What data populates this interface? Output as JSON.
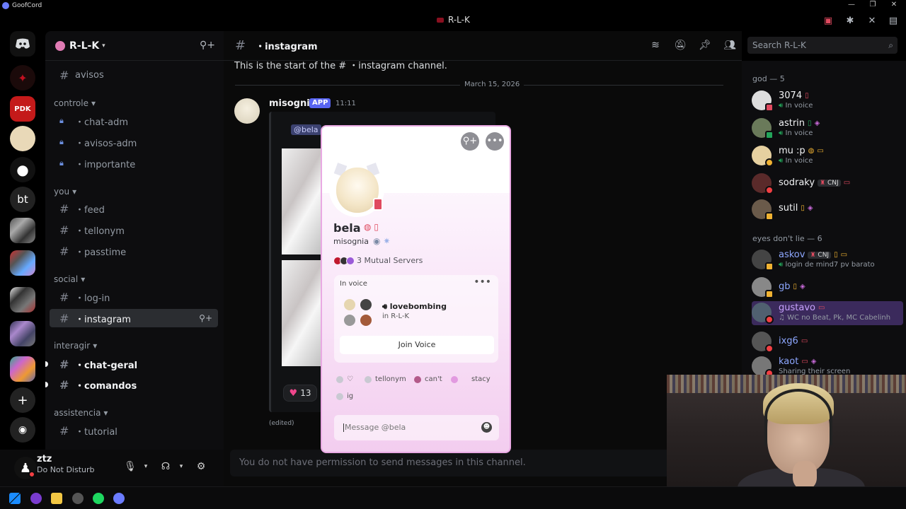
{
  "app": {
    "name": "GoofCord",
    "window_title": "R-L-K"
  },
  "server": {
    "name": "R-L-K",
    "categories": [
      {
        "label": "controle"
      },
      {
        "label": "you"
      },
      {
        "label": "social"
      },
      {
        "label": "interagir"
      },
      {
        "label": "assistencia"
      }
    ],
    "channels": {
      "avisos": "avisos",
      "chat_adm": "・chat-adm",
      "avisos_adm": "・avisos-adm",
      "importante": "・importante",
      "feed": "・feed",
      "tellonym": "・tellonym",
      "passtime": "・passtime",
      "log_in": "・log-in",
      "instagram": "・instagram",
      "chat_geral": "・chat-geral",
      "comandos": "・comandos",
      "tutorial": "・tutorial"
    }
  },
  "guilds": [
    "bt"
  ],
  "user_panel": {
    "username": "ztz",
    "status": "Do Not Disturb"
  },
  "chat": {
    "channel_name": "・instagram",
    "start_text": "This is the start of the # ・instagram channel.",
    "date_divider": "March 15, 2026",
    "message": {
      "author": "misognia",
      "app_tag": "APP",
      "time": "11:11",
      "mention": "@bela",
      "reaction_count": "13",
      "edited": "(edited)"
    },
    "no_permission": "You do not have permission to send messages in this channel.",
    "search_placeholder": "Search R-L-K"
  },
  "members": {
    "groups": [
      {
        "label": "god — 5"
      },
      {
        "label": "eyes don't lie — 6"
      }
    ],
    "list": [
      {
        "name": "3074",
        "sub": "In voice"
      },
      {
        "name": "astrin",
        "sub": "In voice"
      },
      {
        "name": "mu :p",
        "sub": "In voice"
      },
      {
        "name": "sodraky",
        "tag": "CNJ",
        "sub": ""
      },
      {
        "name": "sutil",
        "sub": ""
      },
      {
        "name": "askov",
        "tag": "CNJ",
        "sub": "login de mind7 pv barato"
      },
      {
        "name": "gb",
        "sub": ""
      },
      {
        "name": "gustavo",
        "sub": "WC no Beat, Pk, MC Cabelinh"
      },
      {
        "name": "ixg6",
        "sub": ""
      },
      {
        "name": "kaot",
        "sub": "Sharing their screen"
      }
    ]
  },
  "profile_popout": {
    "display_name": "bela",
    "username": "misognia",
    "mutual_servers": "3 Mutual Servers",
    "voice_label": "In voice",
    "voice_channel": "lovebombing",
    "voice_server": "in R-L-K",
    "join_button": "Join Voice",
    "roles": [
      "♡",
      "tellonym",
      "can't",
      "stacy",
      "ig"
    ],
    "message_placeholder": "Message @bela"
  },
  "colors": {
    "accent": "#5865f2",
    "dnd": "#f23f43",
    "popout_border": "#e9a9e3",
    "heart": "#f0468c"
  }
}
